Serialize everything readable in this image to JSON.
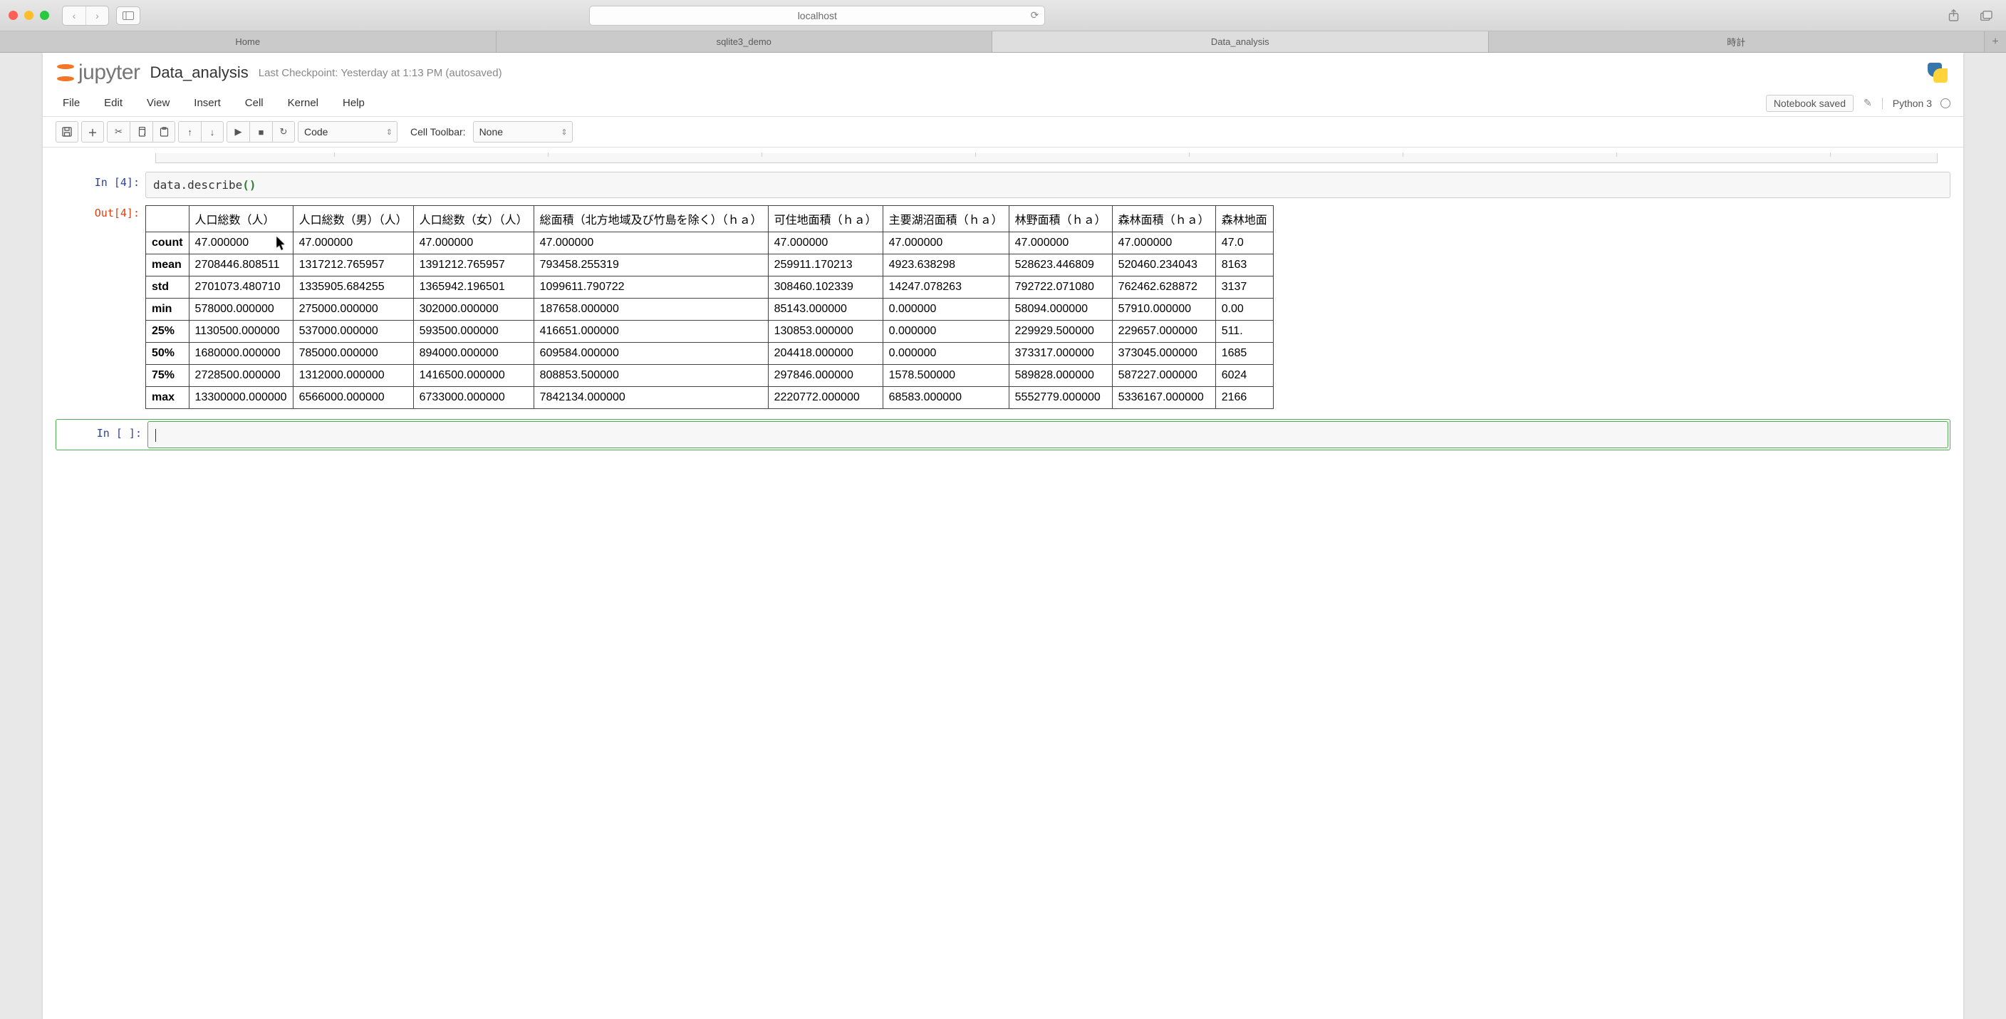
{
  "browser": {
    "url": "localhost",
    "tabs": [
      "Home",
      "sqlite3_demo",
      "Data_analysis",
      "時計"
    ],
    "active_tab_index": 2
  },
  "jupyter": {
    "logo_text": "jupyter",
    "notebook_title": "Data_analysis",
    "checkpoint": "Last Checkpoint: Yesterday at 1:13 PM (autosaved)",
    "menu": [
      "File",
      "Edit",
      "View",
      "Insert",
      "Cell",
      "Kernel",
      "Help"
    ],
    "status": "Notebook saved",
    "kernel": "Python 3",
    "toolbar": {
      "cell_type": "Code",
      "cell_toolbar_label": "Cell Toolbar:",
      "cell_toolbar_value": "None"
    }
  },
  "cell_in": {
    "prompt": "In [4]:",
    "code_prefix": "data.describe",
    "code_paren": "()"
  },
  "cell_out": {
    "prompt": "Out[4]:"
  },
  "describe": {
    "columns": [
      "人口総数（人）",
      "人口総数（男）（人）",
      "人口総数（女）（人）",
      "総面積（北方地域及び竹島を除く）（ｈａ）",
      "可住地面積（ｈａ）",
      "主要湖沼面積（ｈａ）",
      "林野面積（ｈａ）",
      "森林面積（ｈａ）",
      "森林地面"
    ],
    "index": [
      "count",
      "mean",
      "std",
      "min",
      "25%",
      "50%",
      "75%",
      "max"
    ],
    "rows": [
      [
        "47.000000",
        "47.000000",
        "47.000000",
        "47.000000",
        "47.000000",
        "47.000000",
        "47.000000",
        "47.000000",
        "47.0"
      ],
      [
        "2708446.808511",
        "1317212.765957",
        "1391212.765957",
        "793458.255319",
        "259911.170213",
        "4923.638298",
        "528623.446809",
        "520460.234043",
        "8163"
      ],
      [
        "2701073.480710",
        "1335905.684255",
        "1365942.196501",
        "1099611.790722",
        "308460.102339",
        "14247.078263",
        "792722.071080",
        "762462.628872",
        "3137"
      ],
      [
        "578000.000000",
        "275000.000000",
        "302000.000000",
        "187658.000000",
        "85143.000000",
        "0.000000",
        "58094.000000",
        "57910.000000",
        "0.00"
      ],
      [
        "1130500.000000",
        "537000.000000",
        "593500.000000",
        "416651.000000",
        "130853.000000",
        "0.000000",
        "229929.500000",
        "229657.000000",
        "511."
      ],
      [
        "1680000.000000",
        "785000.000000",
        "894000.000000",
        "609584.000000",
        "204418.000000",
        "0.000000",
        "373317.000000",
        "373045.000000",
        "1685"
      ],
      [
        "2728500.000000",
        "1312000.000000",
        "1416500.000000",
        "808853.500000",
        "297846.000000",
        "1578.500000",
        "589828.000000",
        "587227.000000",
        "6024"
      ],
      [
        "13300000.000000",
        "6566000.000000",
        "6733000.000000",
        "7842134.000000",
        "2220772.000000",
        "68583.000000",
        "5552779.000000",
        "5336167.000000",
        "2166"
      ]
    ]
  },
  "empty_cell": {
    "prompt": "In [ ]:"
  }
}
